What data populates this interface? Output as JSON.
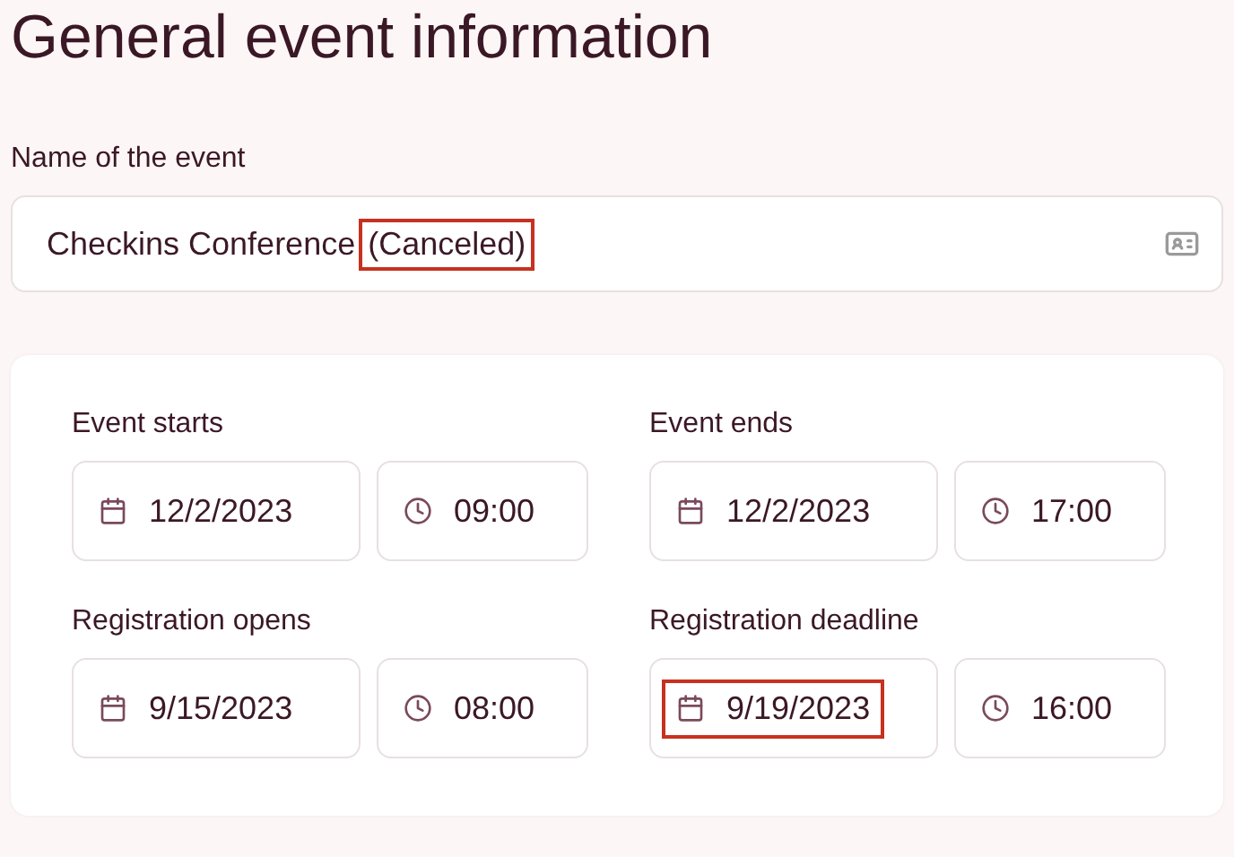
{
  "title": "General event information",
  "name_field": {
    "label": "Name of the event",
    "value_parts": [
      {
        "text": "Checkins Conference",
        "highlighted": false
      },
      {
        "text": "(Canceled)",
        "highlighted": true
      }
    ]
  },
  "schedule": [
    {
      "label": "Event starts",
      "date": {
        "value": "12/2/2023",
        "highlighted": false
      },
      "time": {
        "value": "09:00",
        "highlighted": false
      }
    },
    {
      "label": "Event ends",
      "date": {
        "value": "12/2/2023",
        "highlighted": false
      },
      "time": {
        "value": "17:00",
        "highlighted": false
      }
    },
    {
      "label": "Registration opens",
      "date": {
        "value": "9/15/2023",
        "highlighted": false
      },
      "time": {
        "value": "08:00",
        "highlighted": false
      }
    },
    {
      "label": "Registration deadline",
      "date": {
        "value": "9/19/2023",
        "highlighted": true
      },
      "time": {
        "value": "16:00",
        "highlighted": false
      }
    }
  ]
}
